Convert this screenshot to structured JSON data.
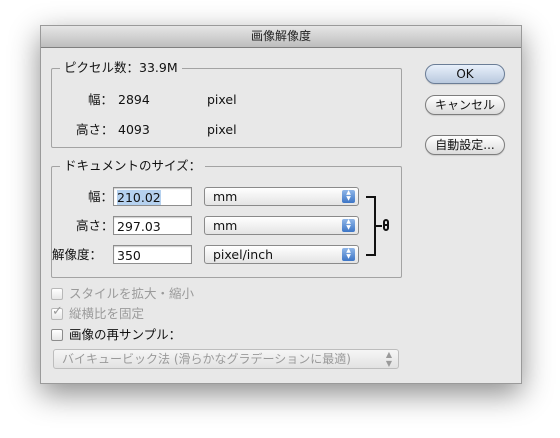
{
  "window": {
    "title": "画像解像度"
  },
  "pixel_dimensions": {
    "legend": "ピクセル数：33.9M",
    "width_label": "幅：",
    "width_value": "2894",
    "width_unit": "pixel",
    "height_label": "高さ：",
    "height_value": "4093",
    "height_unit": "pixel"
  },
  "document_size": {
    "legend": "ドキュメントのサイズ：",
    "width_label": "幅：",
    "width_value": "210.02",
    "width_unit": "mm",
    "height_label": "高さ：",
    "height_value": "297.03",
    "height_unit": "mm",
    "resolution_label": "解像度：",
    "resolution_value": "350",
    "resolution_unit": "pixel/inch",
    "link_icon": "chain-link-icon"
  },
  "buttons": {
    "ok": "OK",
    "cancel": "キャンセル",
    "auto": "自動設定..."
  },
  "options": {
    "scale_styles": {
      "label": "スタイルを拡大・縮小",
      "checked": false,
      "enabled": false
    },
    "constrain_proportions": {
      "label": "縦横比を固定",
      "checked": true,
      "enabled": false
    },
    "resample": {
      "label": "画像の再サンプル：",
      "checked": false,
      "enabled": true
    },
    "resample_method": "バイキュービック法 (滑らかなグラデーションに最適)"
  },
  "colors": {
    "selection": "#b5d1ef",
    "stepper": "#3d76c6",
    "dialog_bg": "#e8e8e8"
  }
}
